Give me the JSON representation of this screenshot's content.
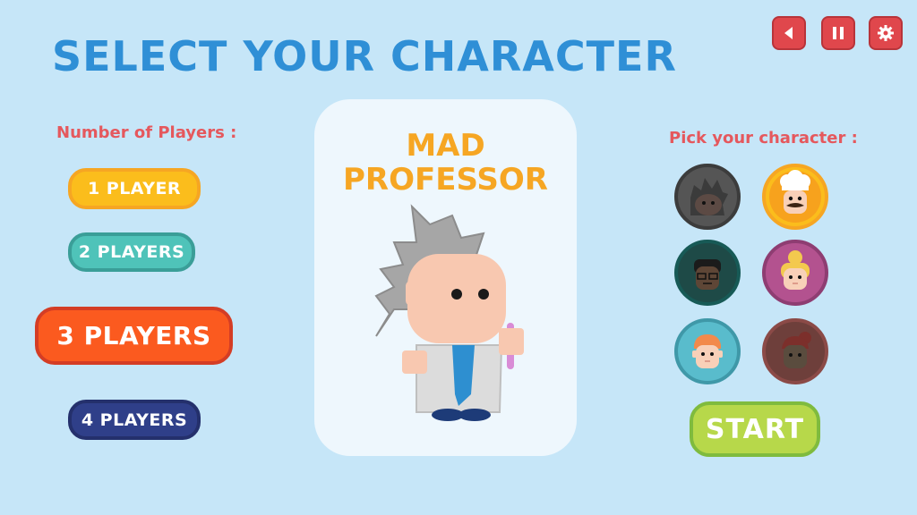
{
  "title": "SELECT YOUR CHARACTER",
  "players_label": "Number of Players :",
  "player_options": [
    {
      "label": "1  PLAYER"
    },
    {
      "label": "2 PLAYERS"
    },
    {
      "label": "3 PLAYERS",
      "selected": true
    },
    {
      "label": "4 PLAYERS"
    }
  ],
  "character": {
    "name_line1": "MAD",
    "name_line2": "PROFESSOR"
  },
  "pick_label": "Pick your character :",
  "characters": [
    {
      "name": "mad-professor",
      "locked": true
    },
    {
      "name": "chef",
      "selected": true
    },
    {
      "name": "glasses-kid",
      "locked": true
    },
    {
      "name": "blonde-girl"
    },
    {
      "name": "red-hair-kid"
    },
    {
      "name": "ponytail-girl",
      "locked": true
    }
  ],
  "start_label": "START",
  "controls": [
    "sound-icon",
    "pause-icon",
    "settings-icon"
  ],
  "colors": {
    "background": "#c6e6f8",
    "title": "#2f8fd6",
    "accent_red": "#e0474c",
    "start": "#b7d84a"
  }
}
